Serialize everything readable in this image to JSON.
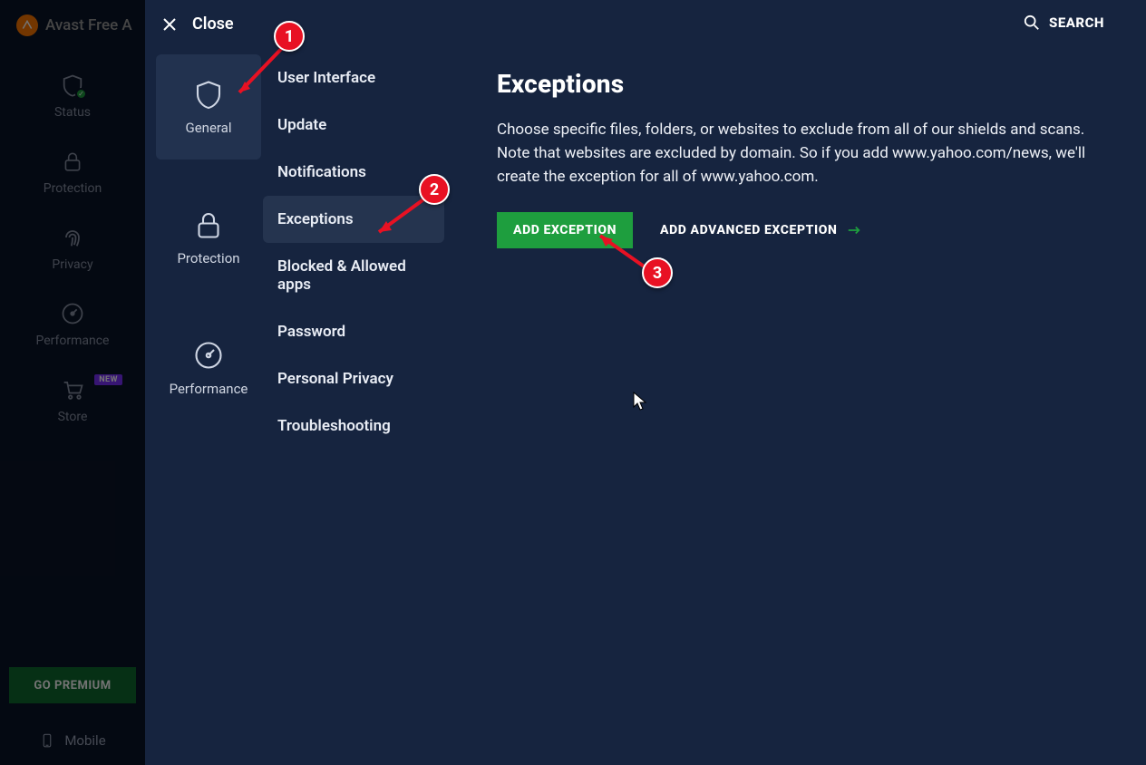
{
  "app": {
    "title_fragment": "Avast Free A",
    "sidebar": {
      "items": [
        {
          "label": "Status"
        },
        {
          "label": "Protection"
        },
        {
          "label": "Privacy"
        },
        {
          "label": "Performance"
        },
        {
          "label": "Store",
          "badge": "NEW"
        }
      ],
      "go_premium": "GO PREMIUM",
      "mobile": "Mobile"
    }
  },
  "settings": {
    "close": "Close",
    "search": "SEARCH",
    "categories": [
      {
        "label": "General",
        "active": true
      },
      {
        "label": "Protection"
      },
      {
        "label": "Performance"
      }
    ],
    "list": [
      {
        "label": "User Interface"
      },
      {
        "label": "Update"
      },
      {
        "label": "Notifications"
      },
      {
        "label": "Exceptions",
        "active": true
      },
      {
        "label": "Blocked & Allowed apps"
      },
      {
        "label": "Password"
      },
      {
        "label": "Personal Privacy"
      },
      {
        "label": "Troubleshooting"
      }
    ],
    "content": {
      "heading": "Exceptions",
      "description": "Choose specific files, folders, or websites to exclude from all of our shields and scans. Note that websites are excluded by domain. So if you add www.yahoo.com/news, we'll create the exception for all of www.yahoo.com.",
      "add_btn": "ADD EXCEPTION",
      "advanced_btn": "ADD ADVANCED EXCEPTION"
    }
  },
  "annotations": {
    "m1": "1",
    "m2": "2",
    "m3": "3"
  }
}
